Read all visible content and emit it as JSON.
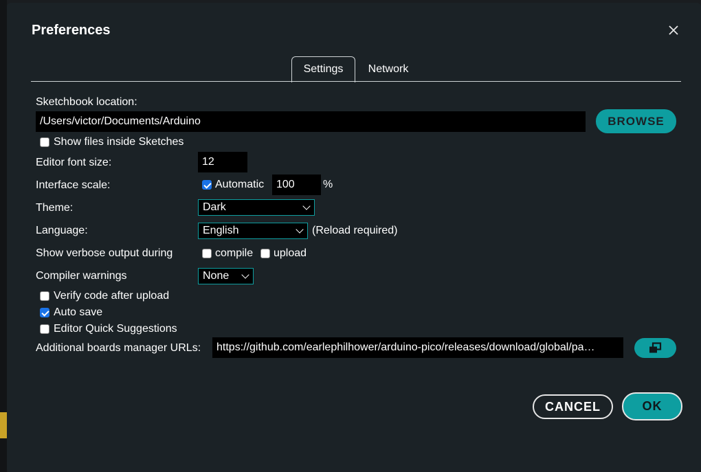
{
  "dialog": {
    "title": "Preferences"
  },
  "tabs": [
    {
      "label": "Settings",
      "active": true
    },
    {
      "label": "Network",
      "active": false
    }
  ],
  "sketchbook": {
    "label": "Sketchbook location:",
    "value": "/Users/victor/Documents/Arduino",
    "browse_label": "BROWSE"
  },
  "show_files": {
    "label": "Show files inside Sketches",
    "checked": false
  },
  "editor_font_size": {
    "label": "Editor font size:",
    "value": "12"
  },
  "interface_scale": {
    "label": "Interface scale:",
    "automatic_label": "Automatic",
    "automatic_checked": true,
    "value": "100",
    "unit": "%"
  },
  "theme": {
    "label": "Theme:",
    "selected": "Dark"
  },
  "language": {
    "label": "Language:",
    "selected": "English",
    "note": "(Reload required)"
  },
  "verbose": {
    "label": "Show verbose output during",
    "compile_label": "compile",
    "compile_checked": false,
    "upload_label": "upload",
    "upload_checked": false
  },
  "compiler_warnings": {
    "label": "Compiler warnings",
    "selected": "None"
  },
  "verify_after_upload": {
    "label": "Verify code after upload",
    "checked": false
  },
  "auto_save": {
    "label": "Auto save",
    "checked": true
  },
  "quick_suggestions": {
    "label": "Editor Quick Suggestions",
    "checked": false
  },
  "boards_urls": {
    "label": "Additional boards manager URLs:",
    "value": "https://github.com/earlephilhower/arduino-pico/releases/download/global/pa…",
    "icon": "open-window-icon"
  },
  "footer": {
    "cancel_label": "CANCEL",
    "ok_label": "OK"
  },
  "colors": {
    "accent": "#0e9ea0",
    "background": "#1b2226",
    "checkbox_checked": "#1a73e8"
  }
}
